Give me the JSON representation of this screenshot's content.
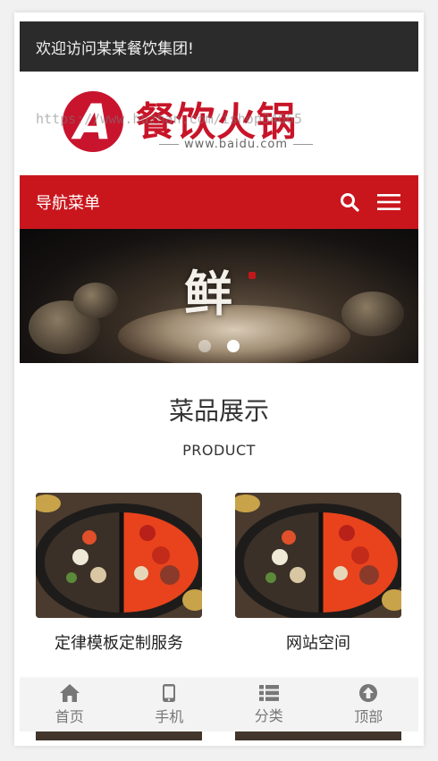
{
  "topbar": {
    "welcome_text": "欢迎访问某某餐饮集团!"
  },
  "logo": {
    "mark": "A",
    "title": "餐饮火锅",
    "subtitle": "www.baidu.com",
    "watermark": "https://www.huzhan.com/ishop34665"
  },
  "navbar": {
    "title": "导航菜单",
    "search_icon": "search-icon",
    "menu_icon": "hamburger-menu-icon",
    "color": "#c9161d"
  },
  "banner": {
    "headline_char": "鲜",
    "slide_count": 2,
    "active_slide": 2
  },
  "section": {
    "title": "菜品展示",
    "subtitle": "PRODUCT"
  },
  "products": [
    {
      "name": "定律模板定制服务",
      "image": "hotpot-image"
    },
    {
      "name": "网站空间",
      "image": "hotpot-image"
    }
  ],
  "tabbar": {
    "items": [
      {
        "label": "首页",
        "icon": "home-icon"
      },
      {
        "label": "手机",
        "icon": "phone-icon"
      },
      {
        "label": "分类",
        "icon": "list-icon"
      },
      {
        "label": "顶部",
        "icon": "arrow-up-circle-icon"
      }
    ]
  }
}
